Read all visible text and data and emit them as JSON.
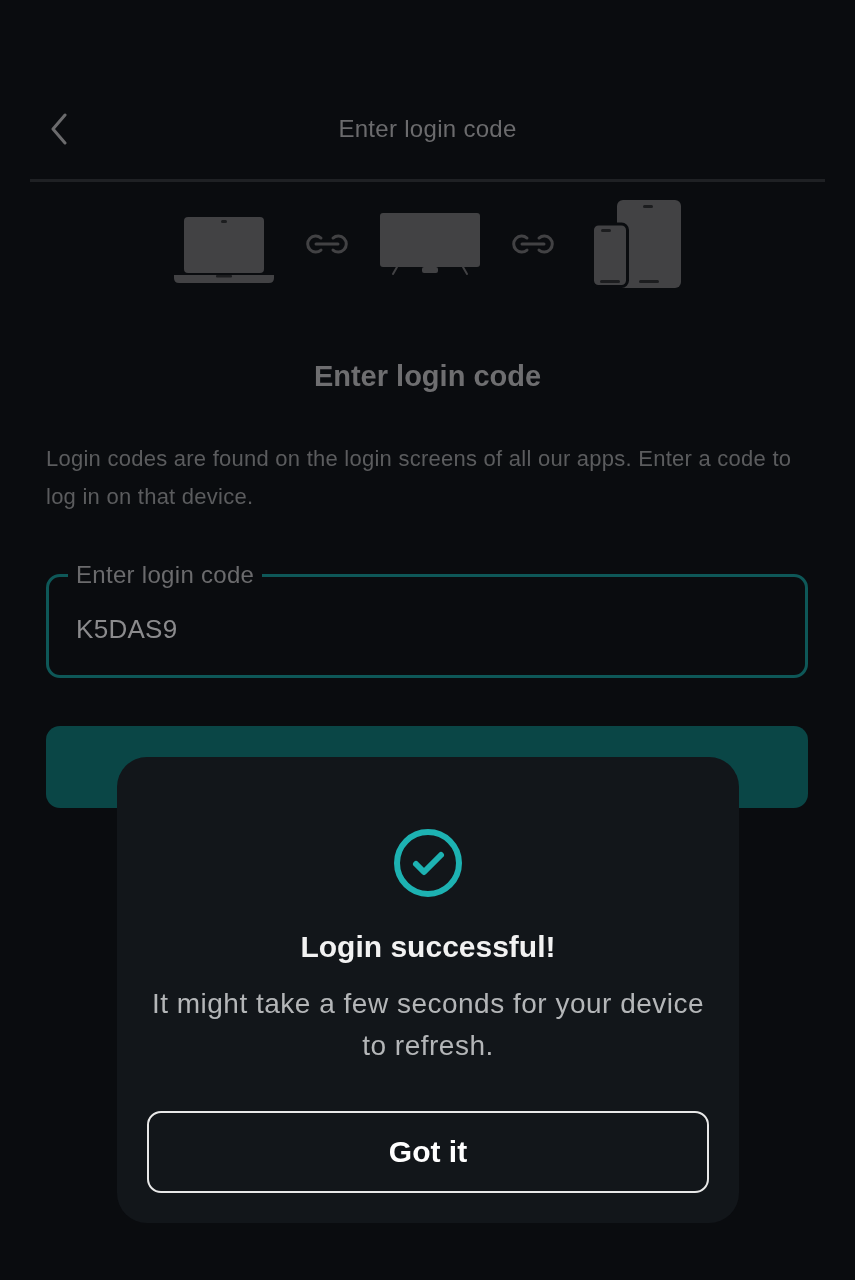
{
  "header": {
    "title": "Enter login code"
  },
  "heading": "Enter login code",
  "description": "Login codes are found on the login screens of all our apps. Enter a code to log in on that device.",
  "code_field": {
    "label": "Enter login code",
    "value": "K5DAS9",
    "focused": true
  },
  "dialog": {
    "title": "Login successful!",
    "message": "It might take a few seconds for your device to refresh.",
    "button": "Got it"
  }
}
